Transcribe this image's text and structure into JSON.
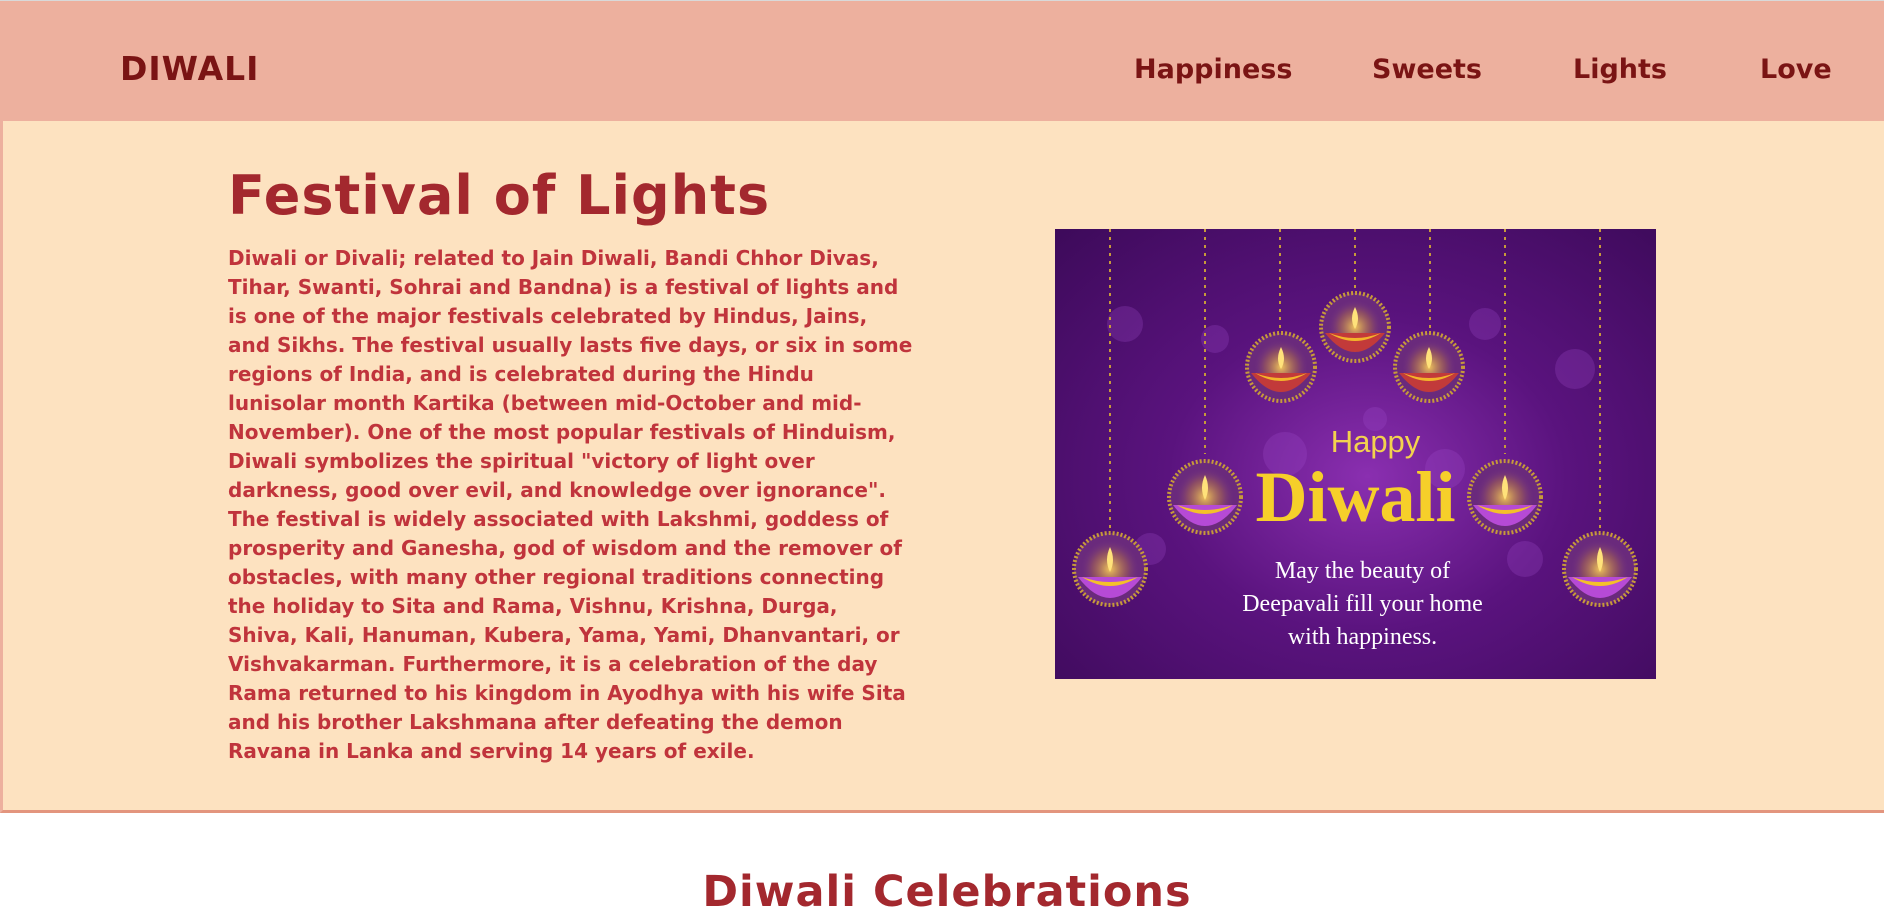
{
  "navbar": {
    "brand": "DIWALI",
    "links": [
      "Happiness",
      "Sweets",
      "Lights",
      "Love"
    ],
    "background": "#edb09e",
    "text_color": "#7a1414"
  },
  "hero": {
    "title": "Festival of Lights",
    "paragraph": "Diwali or Divali; related to Jain Diwali, Bandi Chhor Divas, Tihar, Swanti, Sohrai and Bandna) is a festival of lights and is one of the major festivals celebrated by Hindus, Jains, and Sikhs. The festival usually lasts five days, or six in some regions of India, and is celebrated during the Hindu lunisolar month Kartika (between mid-October and mid-November). One of the most popular festivals of Hinduism, Diwali symbolizes the spiritual \"victory of light over darkness, good over evil, and knowledge over ignorance\". The festival is widely associated with Lakshmi, goddess of prosperity and Ganesha, god of wisdom and the remover of obstacles, with many other regional traditions connecting the holiday to Sita and Rama, Vishnu, Krishna, Durga, Shiva, Kali, Hanuman, Kubera, Yama, Yami, Dhanvantari, or Vishvakarman. Furthermore, it is a celebration of the day Rama returned to his kingdom in Ayodhya with his wife Sita and his brother Lakshmana after defeating the demon Ravana in Lanka and serving 14 years of exile.",
    "background": "#fde2c0",
    "title_color": "#a3282e",
    "text_color": "#c0343c"
  },
  "greeting_card": {
    "happy": "Happy",
    "diwali": "Diwali",
    "message": "May the beauty of Deepavali fill your home with happiness."
  },
  "celebrations": {
    "title": "Diwali Celebrations"
  }
}
